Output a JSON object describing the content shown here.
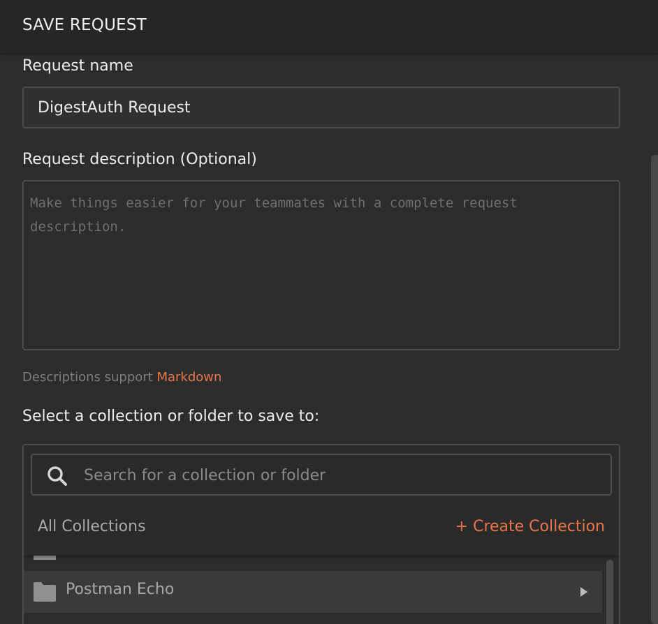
{
  "dialog": {
    "title": "SAVE REQUEST"
  },
  "request_name": {
    "label": "Request name",
    "value": "DigestAuth Request"
  },
  "request_description": {
    "label": "Request description (Optional)",
    "placeholder": "Make things easier for your teammates with a complete request description.",
    "value": ""
  },
  "markdown_note": {
    "text": "Descriptions support ",
    "link": "Markdown"
  },
  "collection_picker": {
    "label": "Select a collection or folder to save to:",
    "search_placeholder": "Search for a collection or folder",
    "search_value": "",
    "section_title": "All Collections",
    "create_label": "+ Create Collection",
    "items": [
      {
        "label": "Postman Echo",
        "icon": "folder-icon",
        "has_children": true
      }
    ]
  },
  "colors": {
    "background": "#2c2c2c",
    "header": "#262626",
    "accent": "#e9774b",
    "border": "#4d4d4d",
    "selected_row": "#3a3a3a"
  }
}
